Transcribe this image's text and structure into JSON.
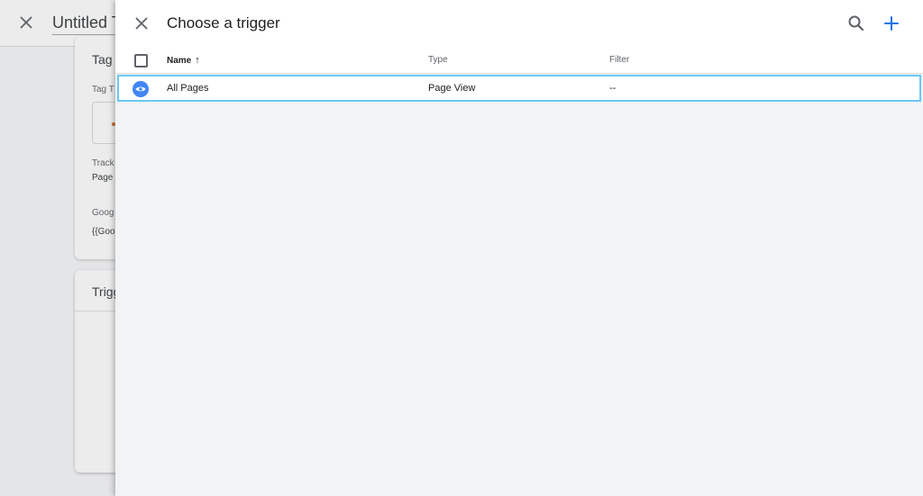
{
  "background": {
    "title": "Untitled Ta",
    "card1": {
      "title": "Tag c",
      "tag_type_label": "Tag T",
      "tracking_label": "Track",
      "tracking_value": "Page",
      "google_label": "Goog",
      "google_value": "{{Goo"
    },
    "card2": {
      "title": "Trigg"
    }
  },
  "panel": {
    "title": "Choose a trigger",
    "columns": {
      "name": "Name",
      "sort_indicator": "↑",
      "type": "Type",
      "filter": "Filter"
    },
    "rows": [
      {
        "icon": "eye-icon",
        "name": "All Pages",
        "type": "Page View",
        "filter": "--"
      }
    ]
  },
  "colors": {
    "accent": "#1a73e8",
    "row_icon": "#4285f4",
    "row_highlight": "#6cc8f2",
    "panel_bg": "#f1f3f4"
  }
}
